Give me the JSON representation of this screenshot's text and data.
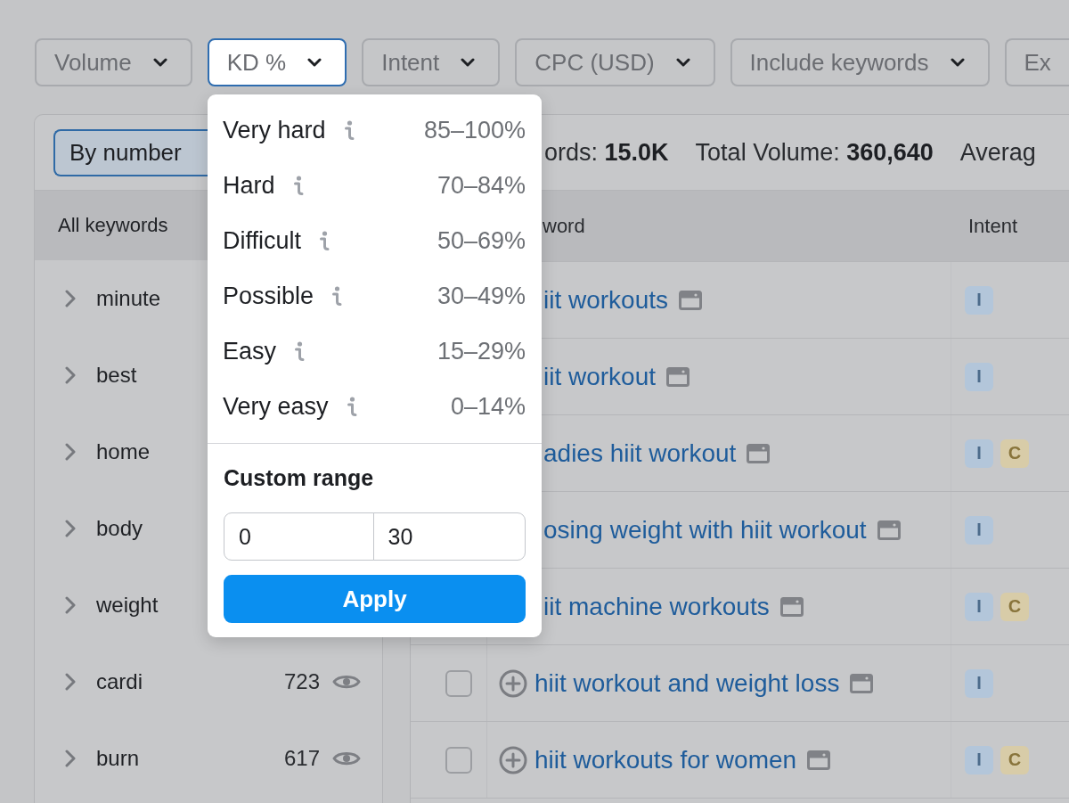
{
  "filters": [
    {
      "label": "Volume",
      "selected": false,
      "caret": true
    },
    {
      "label": "KD %",
      "selected": true,
      "caret": true
    },
    {
      "label": "Intent",
      "selected": false,
      "caret": true
    },
    {
      "label": "CPC (USD)",
      "selected": false,
      "caret": true
    },
    {
      "label": "Include keywords",
      "selected": false,
      "caret": true
    },
    {
      "label": "Ex",
      "selected": false,
      "caret": false
    }
  ],
  "groups_panel": {
    "tabs": [
      {
        "label": "By number",
        "selected": true
      }
    ],
    "header": "All keywords",
    "groups": [
      {
        "name": "minute"
      },
      {
        "name": "best"
      },
      {
        "name": "home"
      },
      {
        "name": "body"
      },
      {
        "name": "weight"
      },
      {
        "name": "cardi",
        "count": "723"
      },
      {
        "name": "burn",
        "count": "617"
      }
    ]
  },
  "keywords_panel": {
    "stats": [
      "ords: **15.0K**",
      "Total Volume: **360,640**",
      "Averag"
    ],
    "columns": [
      "word",
      "Intent"
    ],
    "rows": [
      {
        "keyword": "iit workouts",
        "intents": [
          {
            "label": "I",
            "color": "#b3c6da"
          }
        ]
      },
      {
        "keyword": "iit workout",
        "intents": [
          {
            "label": "I",
            "color": "#b3c6da"
          }
        ]
      },
      {
        "keyword": "adies hiit workout",
        "intents": [
          {
            "label": "I",
            "color": "#b3c6da"
          },
          {
            "label": "C",
            "color": "#d8cca8"
          }
        ]
      },
      {
        "keyword": "osing weight with hiit workout",
        "intents": [
          {
            "label": "I",
            "color": "#b3c6da"
          }
        ]
      },
      {
        "keyword": "iit machine workouts",
        "intents": [
          {
            "label": "I",
            "color": "#b3c6da"
          },
          {
            "label": "C",
            "color": "#d8cca8"
          }
        ]
      },
      {
        "keyword": "hiit workout and weight loss",
        "checked": false,
        "intents": [
          {
            "label": "I",
            "color": "#b3c6da"
          }
        ]
      },
      {
        "keyword": "hiit workouts for women",
        "checked": false,
        "intents": [
          {
            "label": "I",
            "color": "#b3c6da"
          },
          {
            "label": "C",
            "color": "#d8cca8"
          }
        ]
      }
    ]
  },
  "kd_menu": {
    "options": [
      {
        "label": "Very hard",
        "range": "85–100%"
      },
      {
        "label": "Hard",
        "range": "70–84%"
      },
      {
        "label": "Difficult",
        "range": "50–69%"
      },
      {
        "label": "Possible",
        "range": "30–49%"
      },
      {
        "label": "Easy",
        "range": "15–29%"
      },
      {
        "label": "Very easy",
        "range": "0–14%"
      }
    ],
    "custom_range": {
      "title": "Custom range",
      "from": "0",
      "to": "30"
    },
    "apply_button": "Apply"
  }
}
